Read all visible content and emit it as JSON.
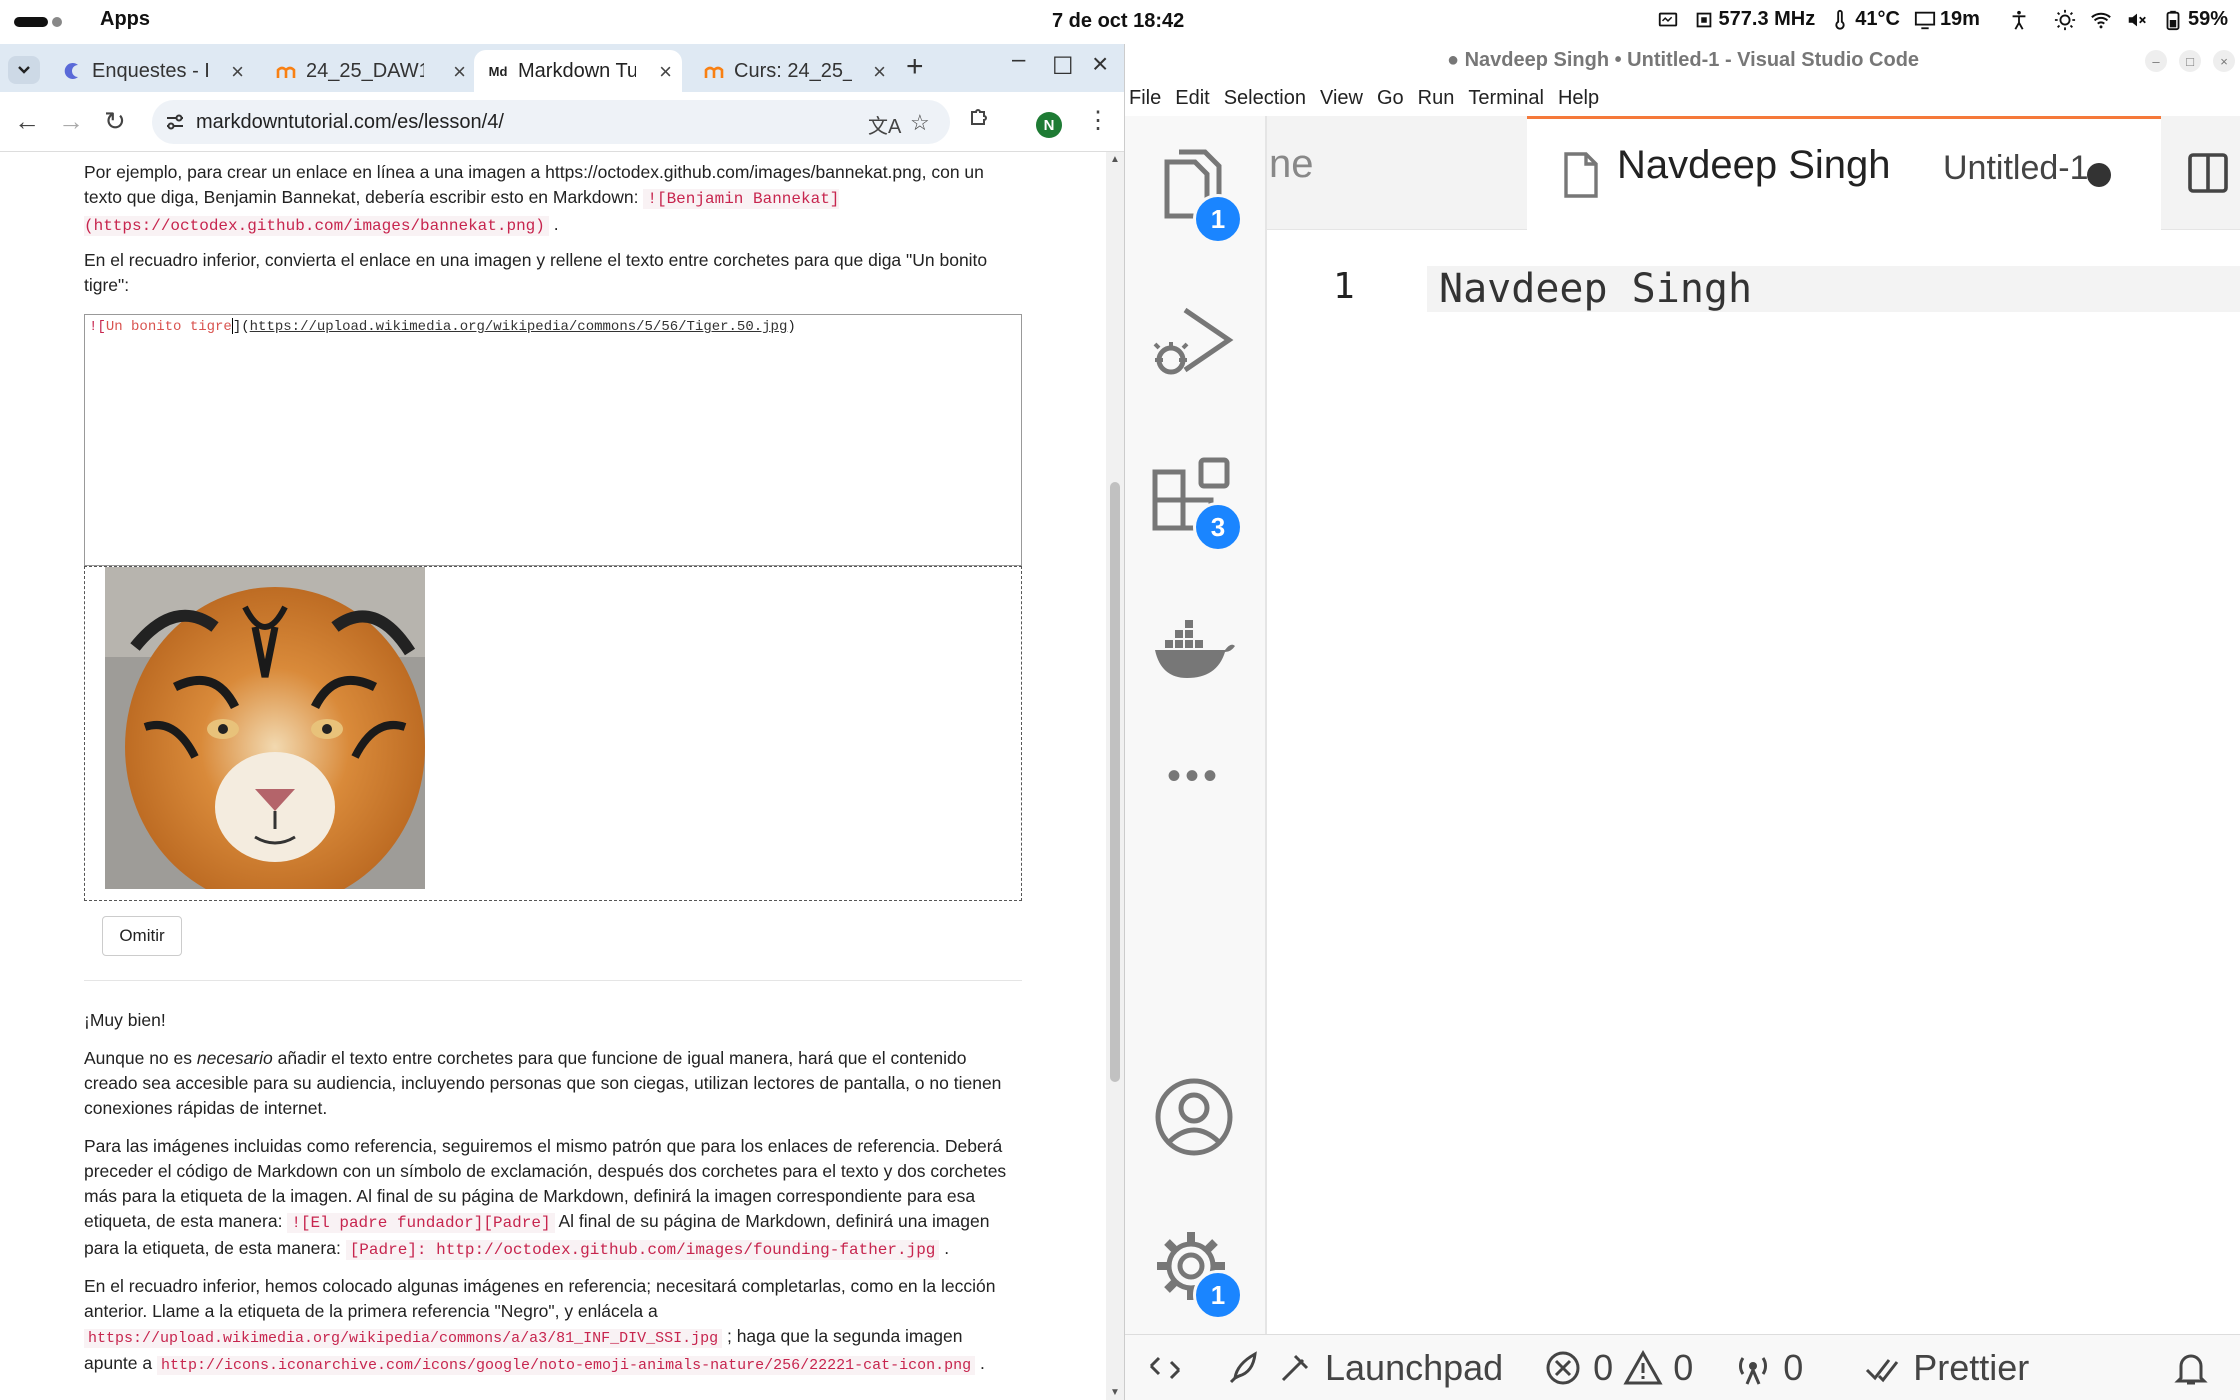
{
  "system": {
    "apps_label": "Apps",
    "datetime": "7 de oct  18:42",
    "cpu_freq": "577.3 MHz",
    "temp": "41°C",
    "screen_time": "19m",
    "battery": "59%"
  },
  "browser": {
    "tabs": [
      {
        "title": "Enquestes - I",
        "icon": "moodle-survey-icon"
      },
      {
        "title": "24_25_DAW1",
        "icon": "moodle-icon"
      },
      {
        "title": "Markdown Tu",
        "icon": "md-icon",
        "fav_text": "Md"
      },
      {
        "title": "Curs: 24_25_",
        "icon": "moodle-icon"
      }
    ],
    "url": "markdowntutorial.com/es/lesson/4/",
    "profile_initial": "N"
  },
  "lesson": {
    "p1_text": "Por ejemplo, para crear un enlace en línea a una imagen a https://octodex.github.com/images/bannekat.png, con un texto que diga, Benjamin Bannekat, debería escribir esto en Markdown:",
    "p1_code": "![Benjamin Bannekat](https://octodex.github.com/images/bannekat.png)",
    "p1_end": " .",
    "p2_text": "En el recuadro inferior, convierta el enlace en una imagen y rellene el texto entre corchetes para que diga \"Un bonito tigre\":",
    "editor_bang": "![",
    "editor_alt": "Un bonito tigre",
    "editor_mid": "](",
    "editor_url": "https://upload.wikimedia.org/wikipedia/commons/5/56/Tiger.50.jpg",
    "editor_end": ")",
    "skip_label": "Omitir",
    "p3": "¡Muy bien!",
    "p4_a": "Aunque no es ",
    "p4_em": "necesario",
    "p4_b": " añadir el texto entre corchetes para que funcione de igual manera, hará que el contenido creado sea accesible para su audiencia, incluyendo personas que son ciegas, utilizan lectores de pantalla, o no tienen conexiones rápidas de internet.",
    "p5_a": "Para las imágenes incluidas como referencia, seguiremos el mismo patrón que para los enlaces de referencia. Deberá preceder el código de Markdown con un símbolo de exclamación, después dos corchetes para el texto y dos corchetes más para la etiqueta de la imagen. Al final de su página de Markdown, definirá la imagen correspondiente para esa etiqueta, de esta manera: ",
    "p5_code1": "![El padre fundador][Padre]",
    "p5_b": " Al final de su página de Markdown, definirá una imagen para la etiqueta, de esta manera: ",
    "p5_code2": "[Padre]: http://octodex.github.com/images/founding-father.jpg",
    "p5_c": " .",
    "p6_a": "En el recuadro inferior, hemos colocado algunas imágenes en referencia; necesitará completarlas, como en la lección anterior. Llame a la etiqueta de la primera referencia \"Negro\", y enlácela a ",
    "p6_code1": "https://upload.wikimedia.org/wikipedia/commons/a/a3/81_INF_DIV_SSI.jpg",
    "p6_b": " ; haga que la segunda imagen apunte a ",
    "p6_code2": "http://icons.iconarchive.com/icons/google/noto-emoji-animals-nature/256/22221-cat-icon.png",
    "p6_c": " ."
  },
  "vscode": {
    "title": "● Navdeep Singh • Untitled-1 - Visual Studio Code",
    "menu": [
      "File",
      "Edit",
      "Selection",
      "View",
      "Go",
      "Run",
      "Terminal",
      "Help"
    ],
    "prev_tab_fragment": "ne",
    "active_tab_name": "Navdeep Singh",
    "active_tab_desc": "Untitled-1",
    "line_number": "1",
    "code_line": "Navdeep Singh",
    "badges": {
      "explorer": "1",
      "extensions": "3",
      "settings": "1"
    },
    "status": {
      "launchpad": "Launchpad",
      "errors": "0",
      "warnings": "0",
      "ports": "0",
      "prettier": "Prettier"
    }
  },
  "colors": {
    "accent_blue": "#1a85ff",
    "tab_orange": "#f5793a",
    "code_red": "#c7254e"
  }
}
